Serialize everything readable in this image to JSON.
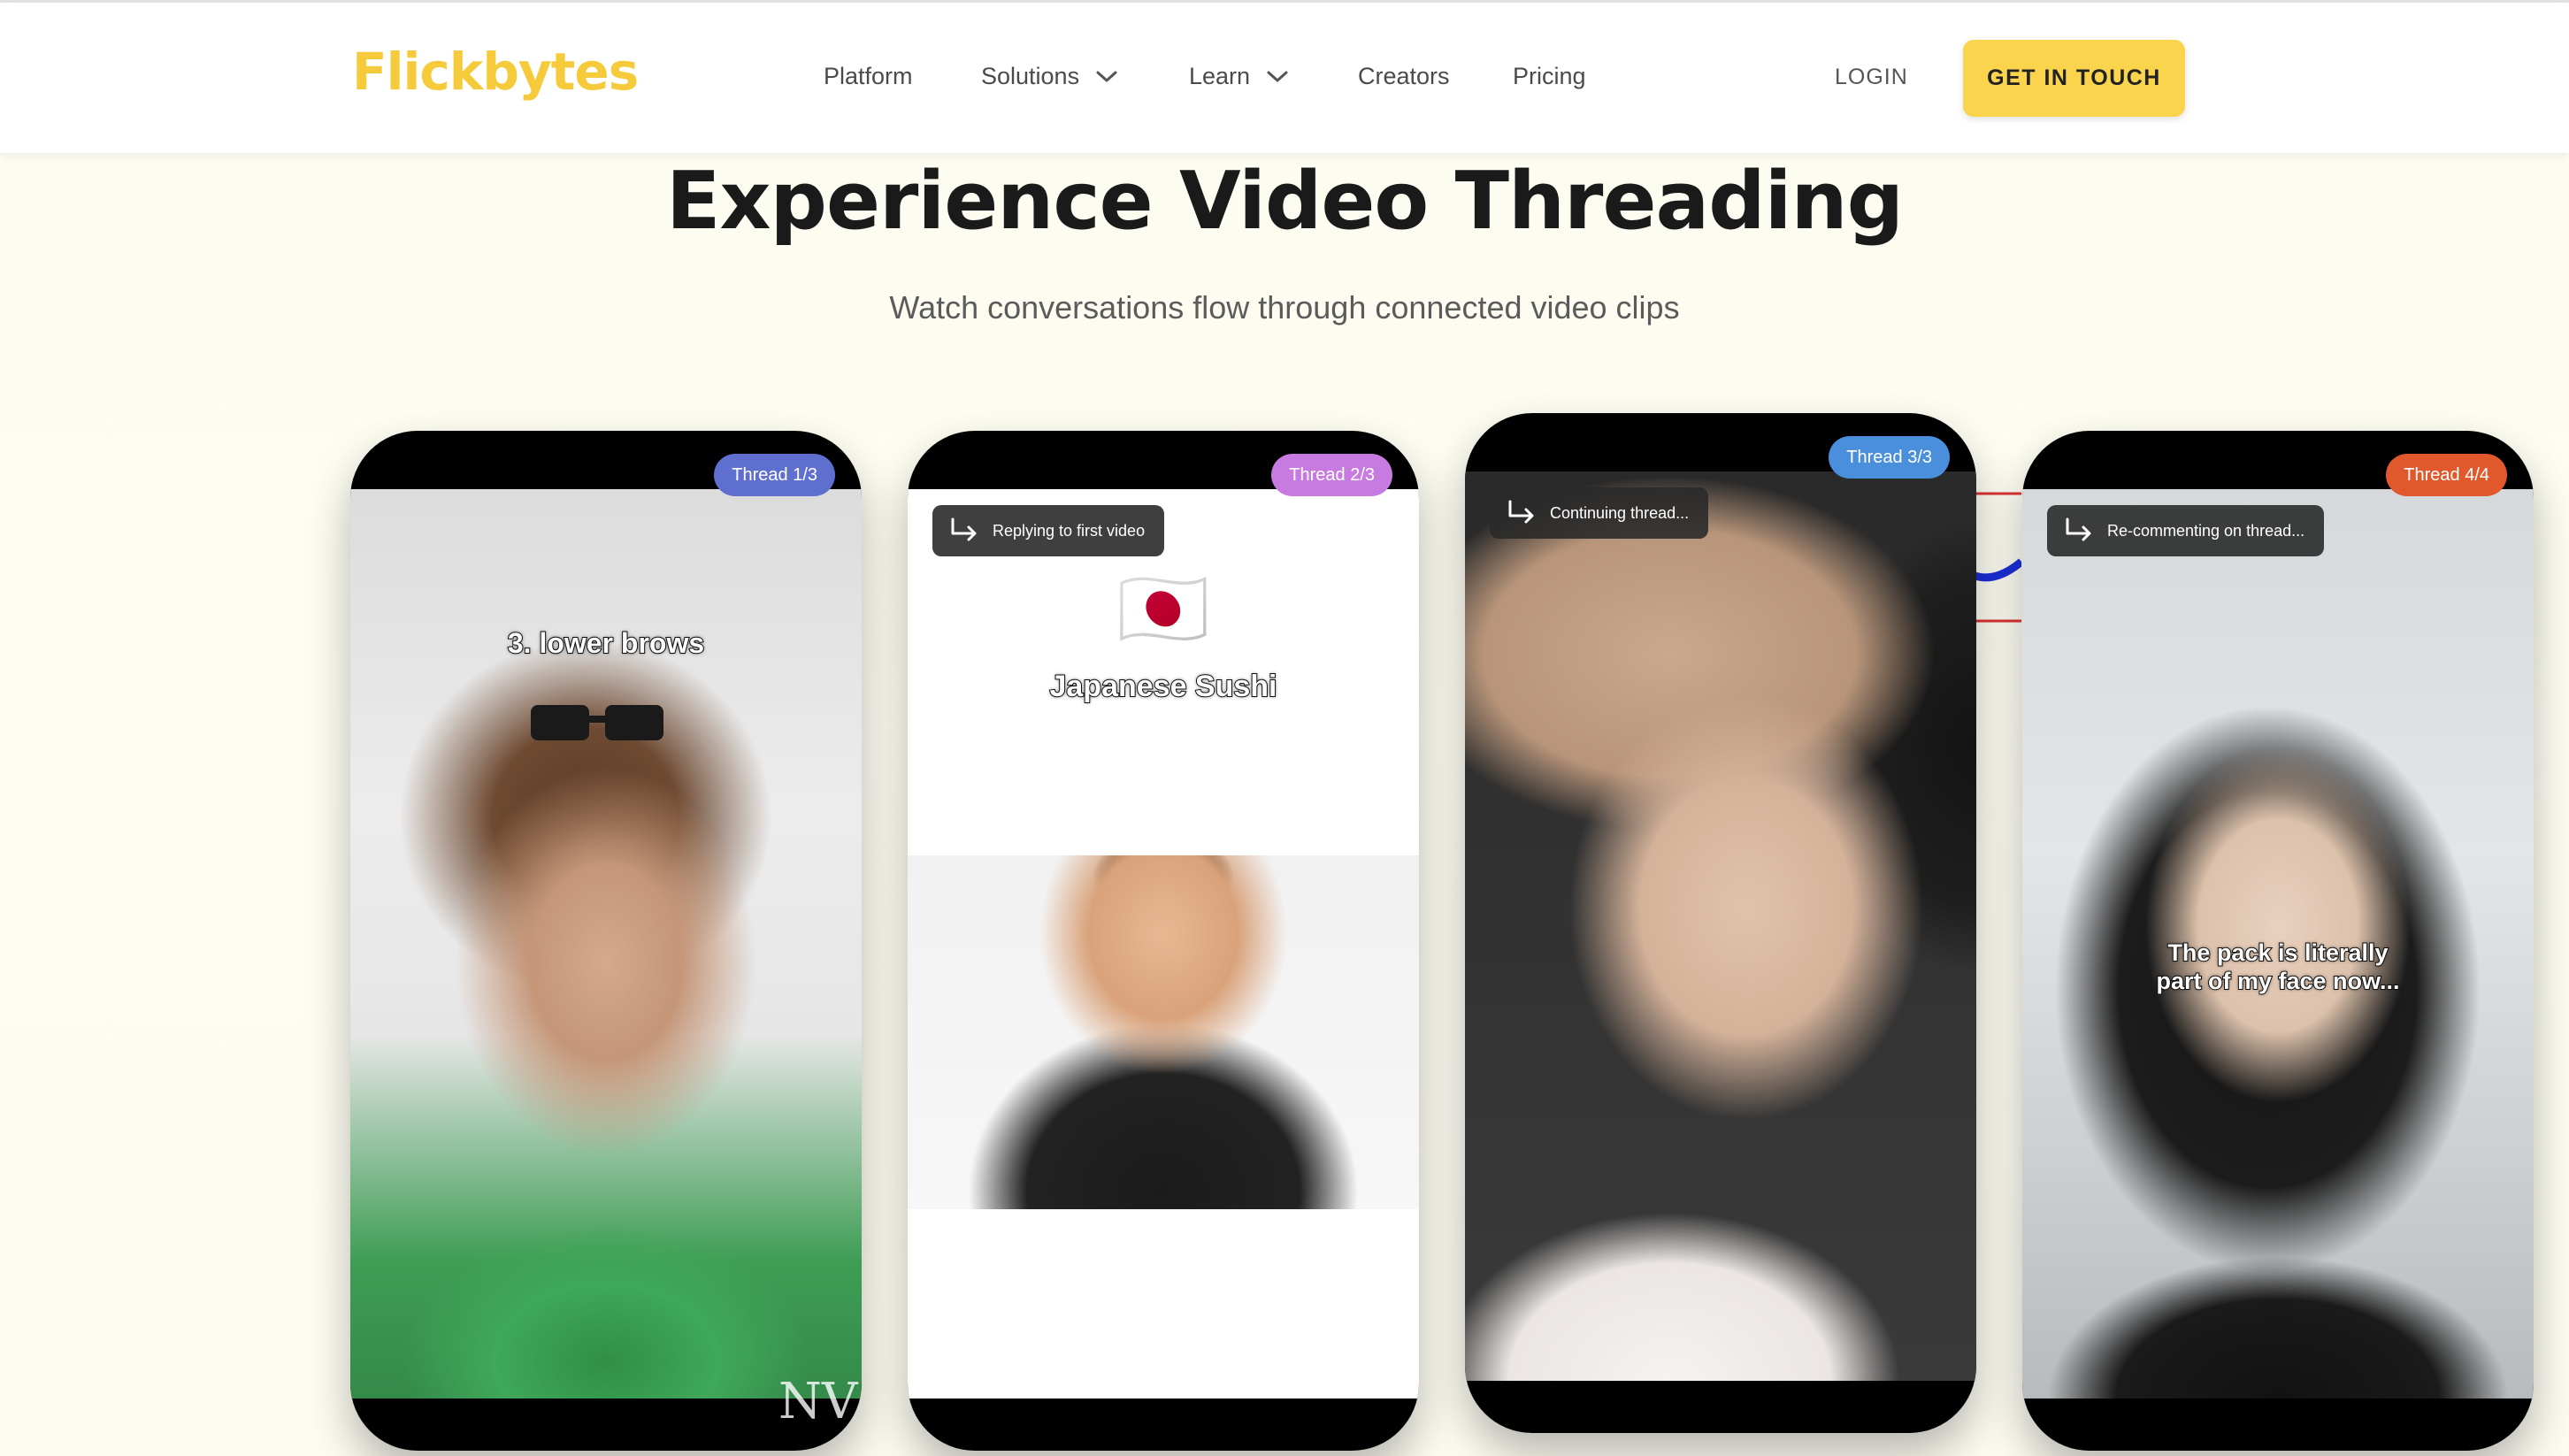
{
  "header": {
    "logo": "Flickbytes",
    "nav": {
      "platform": "Platform",
      "solutions": "Solutions",
      "learn": "Learn",
      "creators": "Creators",
      "pricing": "Pricing"
    },
    "login": "LOGIN",
    "cta": "GET IN TOUCH"
  },
  "hero": {
    "title": "Experience Video Threading",
    "subtitle": "Watch conversations flow through connected video clips"
  },
  "threads": [
    {
      "badge": "Thread 1/3",
      "badge_color": "#5e6fd0",
      "caption": "3. lower brows",
      "watermark": "NV"
    },
    {
      "badge": "Thread 2/3",
      "badge_color": "#c77be0",
      "reply": "Replying to first video",
      "caption": "Japanese Sushi",
      "flag": "🇯🇵"
    },
    {
      "badge": "Thread 3/3",
      "badge_color": "#4a8fdb",
      "reply": "Continuing thread..."
    },
    {
      "badge": "Thread 4/4",
      "badge_color": "#e0582b",
      "reply": "Re-commenting on thread...",
      "caption_line1": "The pack is literally",
      "caption_line2": "part of my face now..."
    }
  ],
  "colors": {
    "brand": "#f5cb3b",
    "cta_bg": "#f9d44c"
  }
}
